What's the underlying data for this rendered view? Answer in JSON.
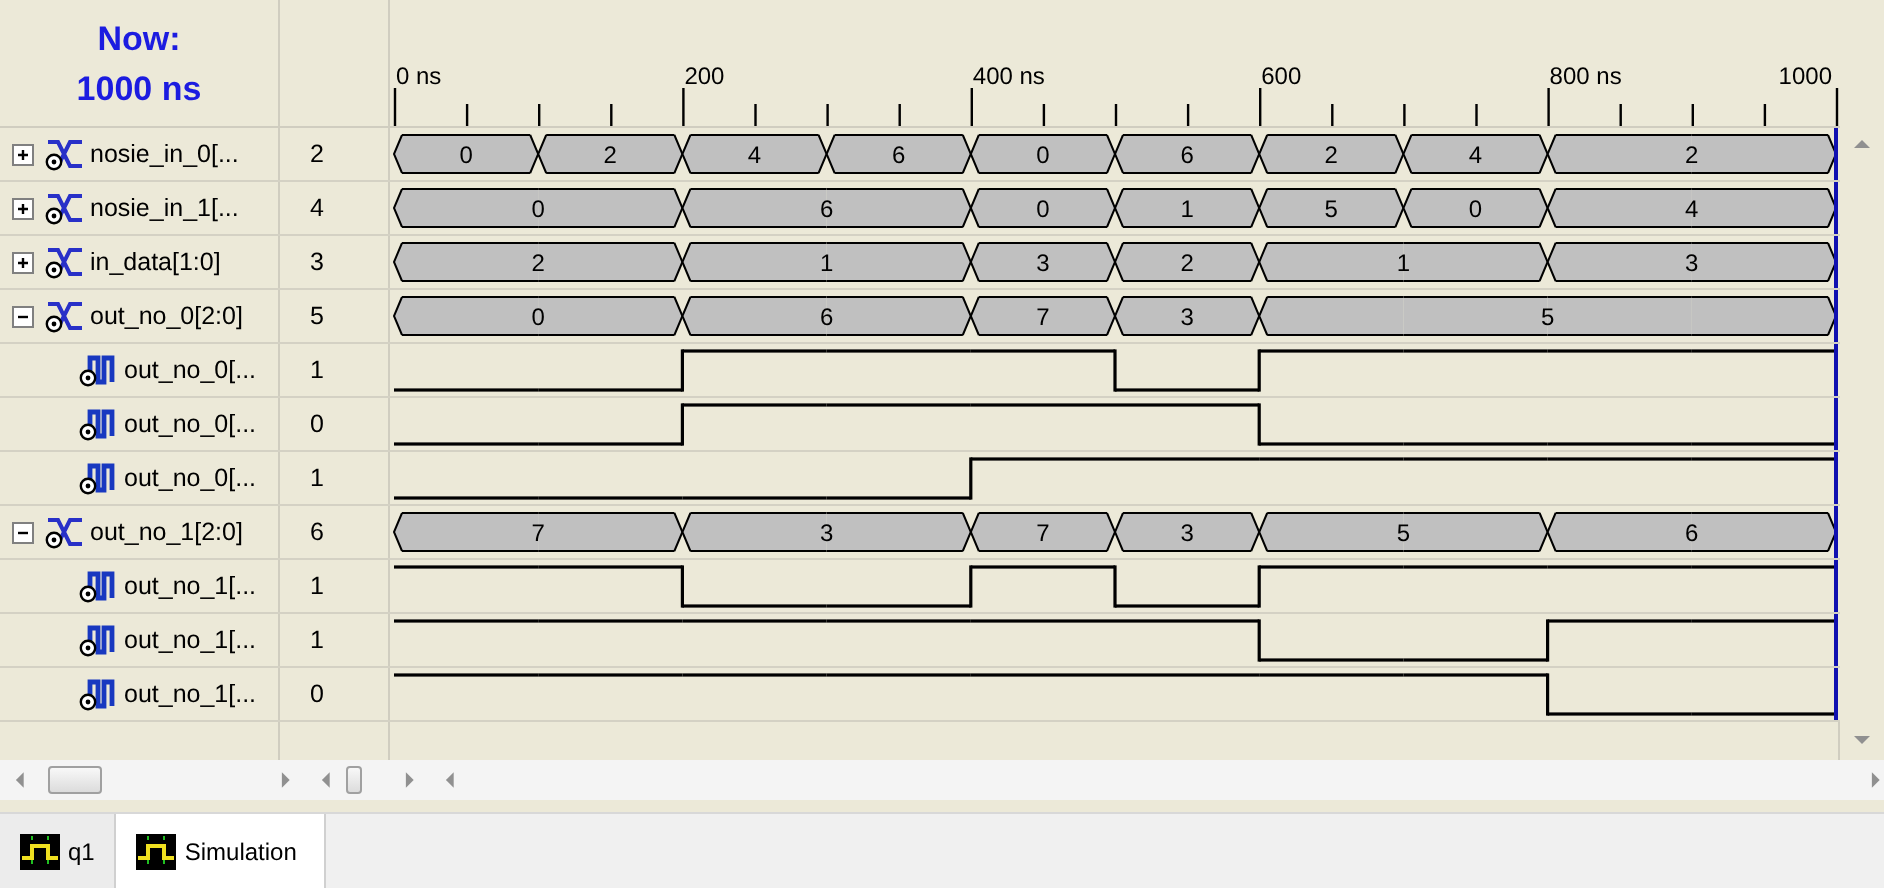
{
  "now": {
    "label": "Now:",
    "time": "1000 ns"
  },
  "time_axis": {
    "ticks": [
      {
        "label": "0 ns"
      },
      {
        "label": "200"
      },
      {
        "label": "400 ns"
      },
      {
        "label": "600"
      },
      {
        "label": "800 ns"
      },
      {
        "label": "1000"
      }
    ]
  },
  "signals": [
    {
      "kind": "bus",
      "name": "nosie_in_0[...",
      "value": "2",
      "expanded": false,
      "slots": [
        {
          "label": "0",
          "continued": false
        },
        {
          "label": "2",
          "continued": false
        },
        {
          "label": "4",
          "continued": false
        },
        {
          "label": "6",
          "continued": false
        },
        {
          "label": "0",
          "continued": false
        },
        {
          "label": "6",
          "continued": false
        },
        {
          "label": "2",
          "continued": false
        },
        {
          "label": "4",
          "continued": false
        },
        {
          "label": "2",
          "continued": false
        },
        {
          "continued": true
        }
      ]
    },
    {
      "kind": "bus",
      "name": "nosie_in_1[...",
      "value": "4",
      "expanded": false,
      "slots": [
        {
          "label": "0",
          "continued": false
        },
        {
          "continued": true
        },
        {
          "label": "6",
          "continued": false
        },
        {
          "continued": true
        },
        {
          "label": "0",
          "continued": false
        },
        {
          "label": "1",
          "continued": false
        },
        {
          "label": "5",
          "continued": false
        },
        {
          "label": "0",
          "continued": false
        },
        {
          "label": "4",
          "continued": false
        },
        {
          "continued": true
        }
      ]
    },
    {
      "kind": "bus",
      "name": "in_data[1:0]",
      "value": "3",
      "expanded": false,
      "slots": [
        {
          "label": "2",
          "continued": false
        },
        {
          "continued": true
        },
        {
          "label": "1",
          "continued": false
        },
        {
          "continued": true
        },
        {
          "label": "3",
          "continued": false
        },
        {
          "label": "2",
          "continued": false
        },
        {
          "label": "1",
          "continued": false
        },
        {
          "continued": true
        },
        {
          "label": "3",
          "continued": false
        },
        {
          "continued": true
        }
      ]
    },
    {
      "kind": "bus",
      "name": "out_no_0[2:0]",
      "value": "5",
      "expanded": true,
      "slots": [
        {
          "label": "0",
          "continued": false
        },
        {
          "continued": true
        },
        {
          "label": "6",
          "continued": false
        },
        {
          "continued": true
        },
        {
          "label": "7",
          "continued": false
        },
        {
          "label": "3",
          "continued": false
        },
        {
          "label": "5",
          "continued": false
        },
        {
          "continued": true
        },
        {
          "continued": true
        },
        {
          "continued": true
        }
      ],
      "children": [
        {
          "kind": "bit",
          "name": "out_no_0[...",
          "value": "1",
          "slots": [
            {
              "high": false
            },
            {
              "high": false
            },
            {
              "high": true
            },
            {
              "high": true
            },
            {
              "high": true
            },
            {
              "high": false
            },
            {
              "high": true
            },
            {
              "high": true
            },
            {
              "high": true
            },
            {
              "high": true
            }
          ]
        },
        {
          "kind": "bit",
          "name": "out_no_0[...",
          "value": "0",
          "slots": [
            {
              "high": false
            },
            {
              "high": false
            },
            {
              "high": true
            },
            {
              "high": true
            },
            {
              "high": true
            },
            {
              "high": true
            },
            {
              "high": false
            },
            {
              "high": false
            },
            {
              "high": false
            },
            {
              "high": false
            }
          ]
        },
        {
          "kind": "bit",
          "name": "out_no_0[...",
          "value": "1",
          "slots": [
            {
              "high": false
            },
            {
              "high": false
            },
            {
              "high": false
            },
            {
              "high": false
            },
            {
              "high": true
            },
            {
              "high": true
            },
            {
              "high": true
            },
            {
              "high": true
            },
            {
              "high": true
            },
            {
              "high": true
            }
          ]
        }
      ]
    },
    {
      "kind": "bus",
      "name": "out_no_1[2:0]",
      "value": "6",
      "expanded": true,
      "slots": [
        {
          "label": "7",
          "continued": false
        },
        {
          "continued": true
        },
        {
          "label": "3",
          "continued": false
        },
        {
          "continued": true
        },
        {
          "label": "7",
          "continued": false
        },
        {
          "label": "3",
          "continued": false
        },
        {
          "label": "5",
          "continued": false
        },
        {
          "continued": true
        },
        {
          "label": "6",
          "continued": false
        },
        {
          "continued": true
        }
      ],
      "children": [
        {
          "kind": "bit",
          "name": "out_no_1[...",
          "value": "1",
          "slots": [
            {
              "high": true
            },
            {
              "high": true
            },
            {
              "high": false
            },
            {
              "high": false
            },
            {
              "high": true
            },
            {
              "high": false
            },
            {
              "high": true
            },
            {
              "high": true
            },
            {
              "high": true
            },
            {
              "high": true
            }
          ]
        },
        {
          "kind": "bit",
          "name": "out_no_1[...",
          "value": "1",
          "slots": [
            {
              "high": true
            },
            {
              "high": true
            },
            {
              "high": true
            },
            {
              "high": true
            },
            {
              "high": true
            },
            {
              "high": true
            },
            {
              "high": false
            },
            {
              "high": false
            },
            {
              "high": true
            },
            {
              "high": true
            }
          ]
        },
        {
          "kind": "bit",
          "name": "out_no_1[...",
          "value": "0",
          "slots": [
            {
              "high": true
            },
            {
              "high": true
            },
            {
              "high": true
            },
            {
              "high": true
            },
            {
              "high": true
            },
            {
              "high": true
            },
            {
              "high": true
            },
            {
              "high": true
            },
            {
              "high": false
            },
            {
              "high": false
            }
          ]
        }
      ]
    }
  ],
  "tabs": [
    {
      "label": "q1",
      "selected": false
    },
    {
      "label": "Simulation",
      "selected": true
    }
  ]
}
